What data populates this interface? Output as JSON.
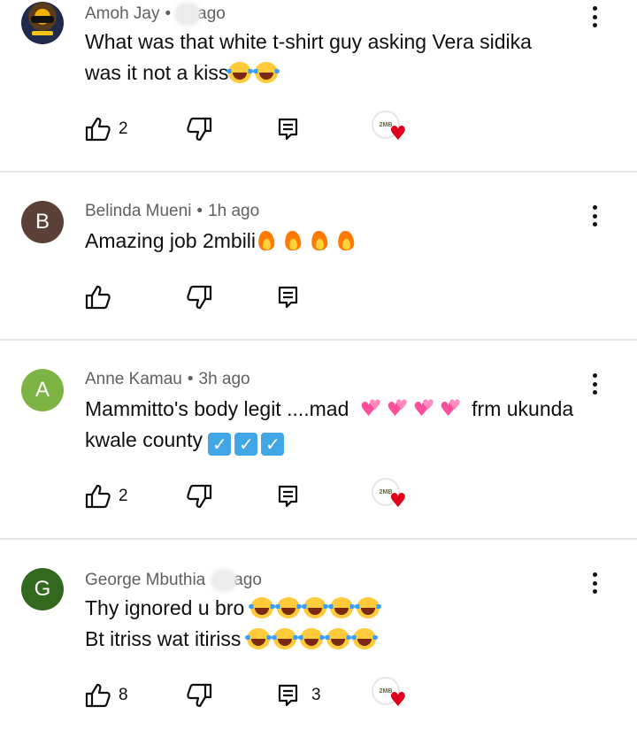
{
  "comments": [
    {
      "author": "Amoh Jay",
      "time": "ago",
      "text_lines": [
        "What was that white t-shirt guy asking Vera sidika",
        "was it not a kiss"
      ],
      "likes": "2",
      "replies": "",
      "creator_hearted": true,
      "avatar_letter": "",
      "avatar_color": ""
    },
    {
      "author": "Belinda Mueni",
      "time": "1h ago",
      "text_lines": [
        "Amazing job 2mbili"
      ],
      "likes": "",
      "replies": "",
      "creator_hearted": false,
      "avatar_letter": "B",
      "avatar_color": "#5b4037"
    },
    {
      "author": "Anne Kamau",
      "time": "3h ago",
      "text_lines": [
        "Mammitto's body legit ....mad",
        "kwale county"
      ],
      "text_suffix": "frm ukunda",
      "likes": "2",
      "replies": "",
      "creator_hearted": true,
      "avatar_letter": "A",
      "avatar_color": "#7cb342"
    },
    {
      "author": "George Mbuthia",
      "time": "ago",
      "text_lines": [
        "Thy ignored u bro",
        "Bt itriss wat itiriss"
      ],
      "likes": "8",
      "replies": "3",
      "creator_hearted": true,
      "avatar_letter": "G",
      "avatar_color": "#33691e"
    }
  ],
  "heart_badge_text": "2MB",
  "icons": [
    "like-icon",
    "dislike-icon",
    "reply-icon",
    "more-vert-icon",
    "creator-heart-icon"
  ]
}
